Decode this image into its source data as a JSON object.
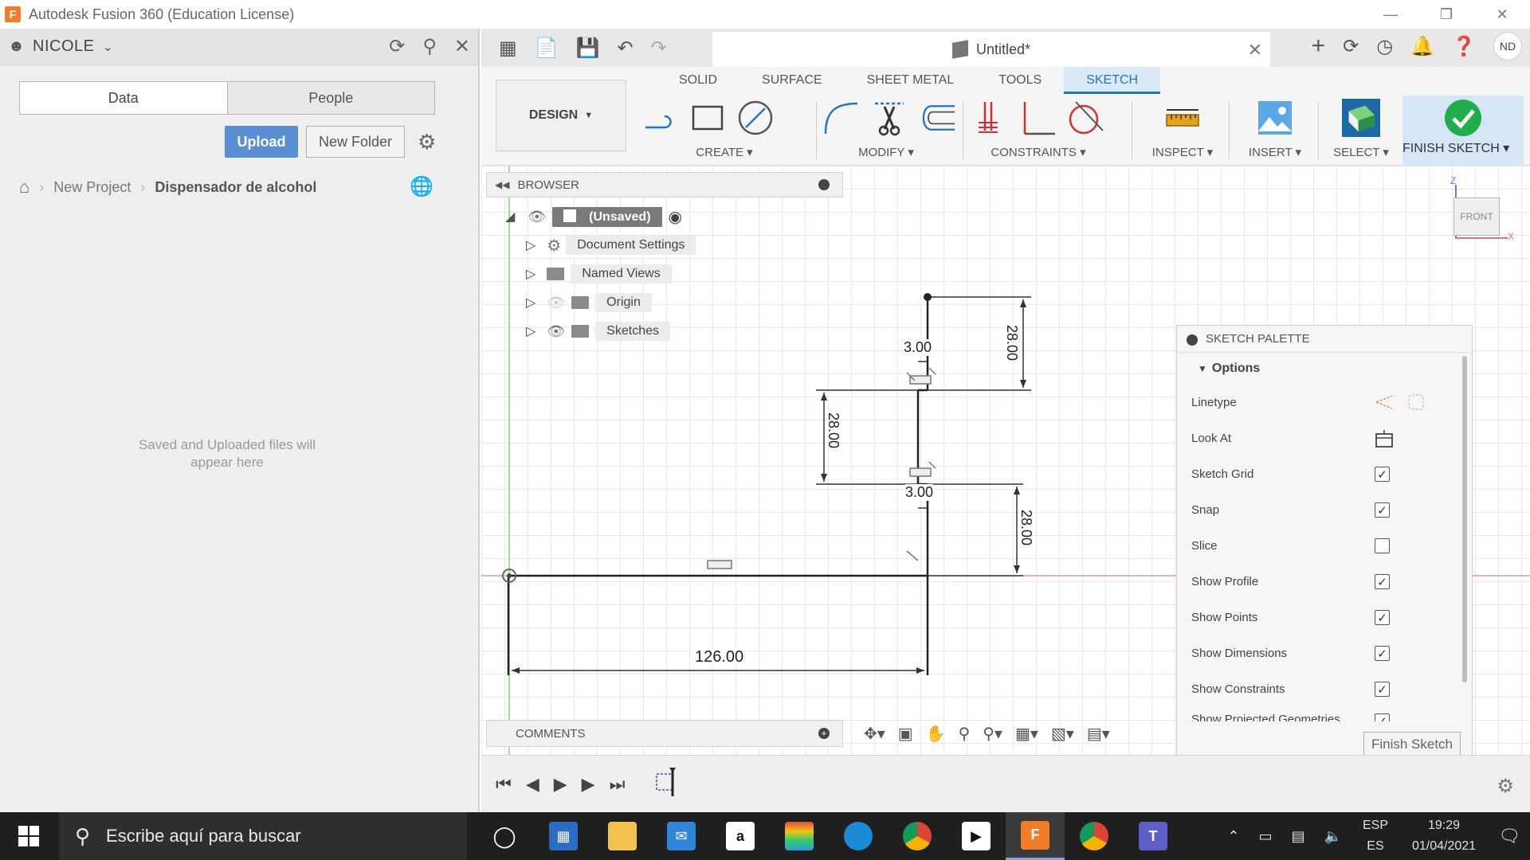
{
  "window": {
    "title": "Autodesk Fusion 360 (Education License)",
    "logo_letter": "F"
  },
  "data_panel": {
    "user": "NICOLE",
    "tabs": [
      "Data",
      "People"
    ],
    "upload_label": "Upload",
    "new_folder_label": "New Folder",
    "breadcrumb": [
      "New Project",
      "Dispensador de alcohol"
    ],
    "empty_message_line1": "Saved and Uploaded files will",
    "empty_message_line2": "appear here"
  },
  "document": {
    "tab_title": "Untitled*",
    "user_initials": "ND"
  },
  "ribbon": {
    "workspace": "DESIGN",
    "tabs": [
      "SOLID",
      "SURFACE",
      "SHEET METAL",
      "TOOLS",
      "SKETCH"
    ],
    "active_tab": "SKETCH",
    "groups": [
      "CREATE",
      "MODIFY",
      "CONSTRAINTS",
      "INSPECT",
      "INSERT",
      "SELECT",
      "FINISH SKETCH"
    ]
  },
  "browser": {
    "title": "BROWSER",
    "root": "(Unsaved)",
    "items": [
      "Document Settings",
      "Named Views",
      "Origin",
      "Sketches"
    ]
  },
  "comments": {
    "title": "COMMENTS"
  },
  "viewcube": {
    "face": "FRONT",
    "axis_z": "Z",
    "axis_x": "X"
  },
  "sketch": {
    "dimensions": {
      "top_height": "28.00",
      "top_width": "3.00",
      "mid_height": "28.00",
      "mid_width": "3.00",
      "low_height": "28.00",
      "base_width": "126.00"
    }
  },
  "sketch_palette": {
    "title": "SKETCH PALETTE",
    "section": "Options",
    "rows": [
      {
        "label": "Linetype",
        "type": "icons"
      },
      {
        "label": "Look At",
        "type": "icon"
      },
      {
        "label": "Sketch Grid",
        "checked": true
      },
      {
        "label": "Snap",
        "checked": true
      },
      {
        "label": "Slice",
        "checked": false
      },
      {
        "label": "Show Profile",
        "checked": true
      },
      {
        "label": "Show Points",
        "checked": true
      },
      {
        "label": "Show Dimensions",
        "checked": true
      },
      {
        "label": "Show Constraints",
        "checked": true
      },
      {
        "label": "Show Projected Geometries",
        "checked": true
      }
    ],
    "finish_label": "Finish Sketch"
  },
  "taskbar": {
    "search_placeholder": "Escribe aquí para buscar",
    "lang_top": "ESP",
    "lang_bottom": "ES",
    "time": "19:29",
    "date": "01/04/2021"
  },
  "colors": {
    "accent": "#1f75c9",
    "upload": "#5a8fd2",
    "finish": "#1fae4a",
    "constraint": "#d32f2f"
  }
}
